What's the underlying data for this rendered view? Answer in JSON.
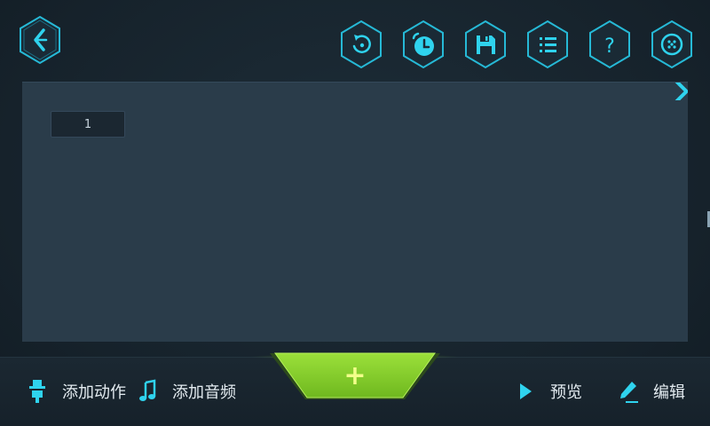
{
  "toolbar": {
    "back": {
      "icon": "back-arrow-icon"
    },
    "buttons": [
      {
        "id": "reset",
        "icon": "reset-icon"
      },
      {
        "id": "timer",
        "icon": "timer-icon"
      },
      {
        "id": "save",
        "icon": "save-icon"
      },
      {
        "id": "list",
        "icon": "list-icon"
      },
      {
        "id": "help",
        "icon": "help-icon",
        "glyph": "?"
      },
      {
        "id": "connect",
        "icon": "robot-connect-icon"
      }
    ]
  },
  "timeline": {
    "frames": [
      {
        "label": "1"
      }
    ]
  },
  "bottom_bar": {
    "add_motion_label": "添加动作",
    "add_audio_label": "添加音频",
    "add_button_glyph": "+",
    "preview_label": "预览",
    "edit_label": "编辑"
  },
  "colors": {
    "accent_cyan": "#2fd3ee",
    "accent_green": "#8ed42c",
    "panel_bg": "#2a3c4a",
    "screen_bg": "#17232d"
  }
}
